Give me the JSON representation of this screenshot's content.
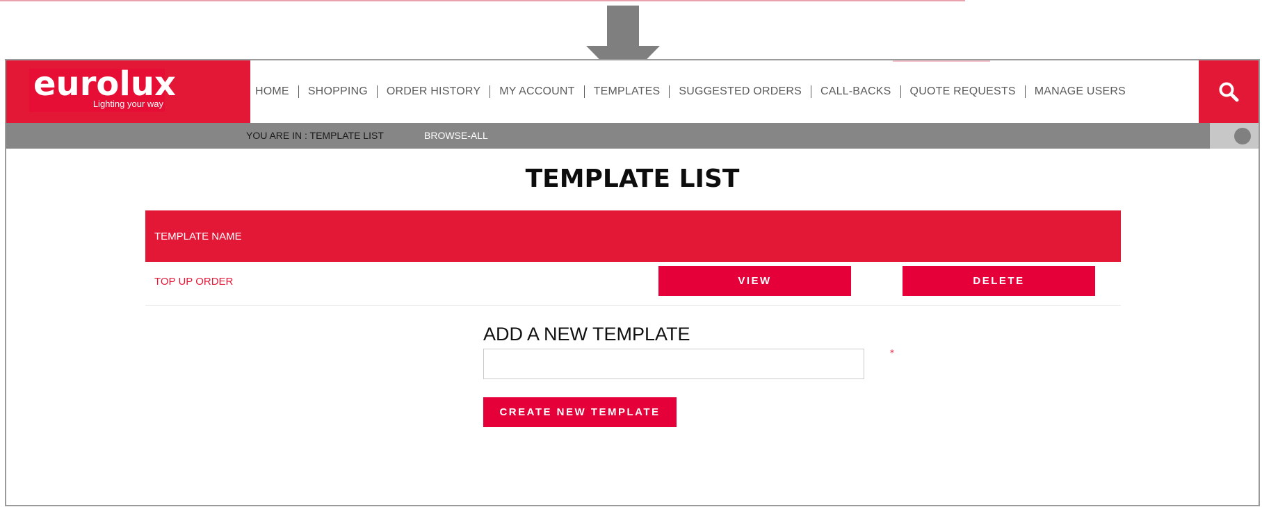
{
  "brand": {
    "logo_text": "eurolux",
    "tagline": "Lighting your way",
    "accent_color": "#e31837"
  },
  "nav": {
    "items": [
      {
        "label": "HOME"
      },
      {
        "label": "SHOPPING"
      },
      {
        "label": "ORDER HISTORY"
      },
      {
        "label": "MY ACCOUNT"
      },
      {
        "label": "TEMPLATES"
      },
      {
        "label": "SUGGESTED ORDERS"
      },
      {
        "label": "CALL-BACKS"
      },
      {
        "label": "QUOTE REQUESTS"
      },
      {
        "label": "MANAGE USERS"
      }
    ],
    "search_icon": "search-icon"
  },
  "breadcrumb": {
    "location": "YOU ARE IN : TEMPLATE LIST",
    "link": "BROWSE-ALL"
  },
  "page": {
    "title": "TEMPLATE LIST"
  },
  "table": {
    "header": "TEMPLATE NAME",
    "rows": [
      {
        "name": "TOP UP ORDER",
        "view_label": "VIEW",
        "delete_label": "DELETE"
      }
    ]
  },
  "add_template": {
    "title": "ADD A NEW TEMPLATE",
    "input_value": "",
    "required_mark": "*",
    "create_label": "CREATE NEW TEMPLATE"
  }
}
